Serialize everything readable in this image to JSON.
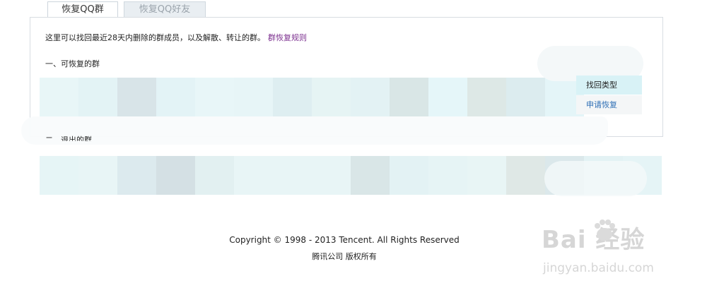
{
  "tabs": [
    {
      "label": "恢复QQ群",
      "active": true
    },
    {
      "label": "恢复QQ好友",
      "active": false
    }
  ],
  "intro": {
    "text": "这里可以找回最近28天内删除的群成员，以及解散、转让的群。",
    "rules_link": "群恢复规则"
  },
  "section1": {
    "title": "一、可恢复的群"
  },
  "section2": {
    "title": "二、退出的群"
  },
  "table": {
    "type_header": "找回类型",
    "apply_link": "申请恢复"
  },
  "row1_colors": [
    "#e8f6f7",
    "#e3f3f5",
    "#d8e4e8",
    "#e3f3f6",
    "#e8f6f8",
    "#e7f5f7",
    "#deeef1",
    "#e6f4f4",
    "#e3f2f4",
    "#d9e6e6",
    "#e5f6f9",
    "#dde8e6",
    "#dcecef",
    "#e4f5f8"
  ],
  "row2_colors": [
    "#e6f5f6",
    "#e8f5f6",
    "#dceaee",
    "#d4e0e4",
    "#e2f0f1",
    "#e8f5f6",
    "#e8f5f6",
    "#e8f5f6",
    "#d9e6e7",
    "#e3f2f4",
    "#e6f4f5",
    "#e8f5f5",
    "#dfe8e6",
    "#dbe8eb",
    "#e3f2f4",
    "#e5f4f6"
  ],
  "footer": {
    "copyright": "Copyright © 1998 - 2013 Tencent. All Rights Reserved",
    "company": "腾讯公司 版权所有"
  },
  "watermark": {
    "main": "Bai  经验",
    "paw": "du",
    "sub": "jingyan.baidu.com"
  }
}
